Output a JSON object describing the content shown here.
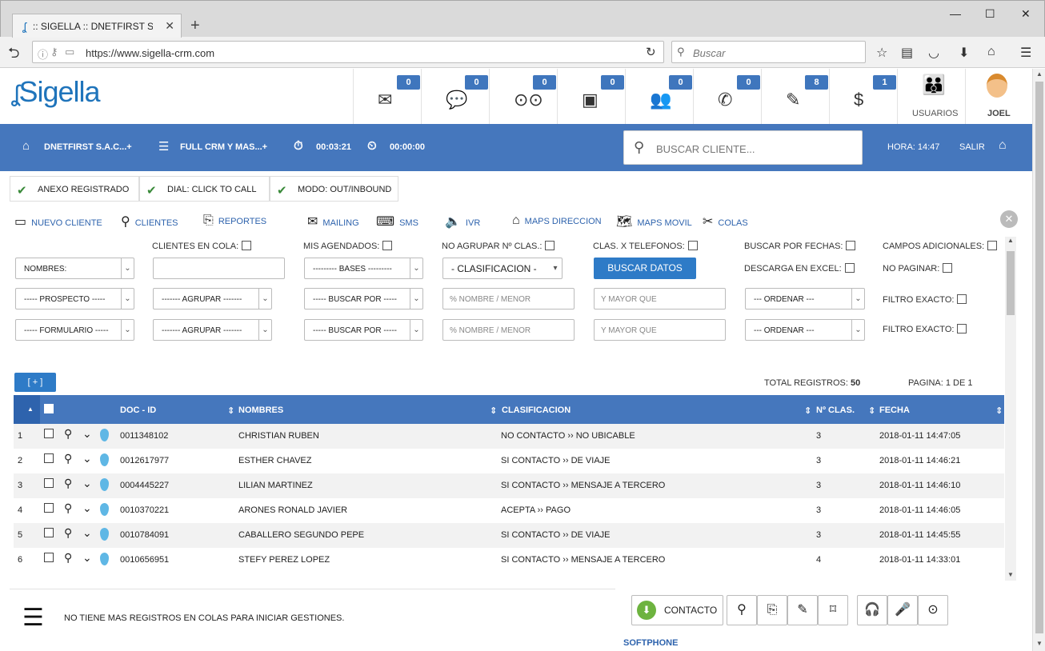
{
  "browser": {
    "tab_title": ":: SIGELLA :: DNETFIRST S....",
    "url": "https://www.sigella-crm.com",
    "search_placeholder": "Buscar"
  },
  "header": {
    "logo": "Sigella",
    "badges": [
      {
        "icon": "mail-icon",
        "count": "0"
      },
      {
        "icon": "sms-icon",
        "count": "0"
      },
      {
        "icon": "voicemail-icon",
        "count": "0"
      },
      {
        "icon": "calendar-icon",
        "count": "0"
      },
      {
        "icon": "group-icon",
        "count": "0"
      },
      {
        "icon": "phone-icon",
        "count": "0"
      },
      {
        "icon": "notes-icon",
        "count": "8"
      },
      {
        "icon": "dollar-icon",
        "count": "1"
      }
    ],
    "usuarios": "USUARIOS",
    "user": "JOEL"
  },
  "bar": {
    "company": "DNETFIRST S.A.C...+",
    "campaign": "FULL CRM Y MAS...+",
    "timer1": "00:03:21",
    "timer2": "00:00:00",
    "search_placeholder": "BUSCAR CLIENTE...",
    "hora": "HORA: 14:47",
    "salir": "SALIR"
  },
  "status": [
    "ANEXO REGISTRADO",
    "DIAL: CLICK TO CALL",
    "MODO: OUT/INBOUND"
  ],
  "menu": [
    "NUEVO CLIENTE",
    "CLIENTES",
    "REPORTES",
    "MAILING",
    "SMS",
    "IVR",
    "MAPS DIRECCION",
    "MAPS MOVIL",
    "COLAS"
  ],
  "filters": {
    "clientes_cola": "CLIENTES EN COLA:",
    "mis_agendados": "MIS AGENDADOS:",
    "no_agrupar": "NO AGRUPAR Nº CLAS.:",
    "clas_telefonos": "CLAS. X TELEFONOS:",
    "buscar_fechas": "BUSCAR POR FECHAS:",
    "campos_adicionales": "CAMPOS ADICIONALES:",
    "descarga_excel": "DESCARGA EN EXCEL:",
    "no_paginar": "NO PAGINAR:",
    "filtro_exacto": "FILTRO EXACTO:",
    "nombres": "NOMBRES:",
    "bases": "--------- BASES ---------",
    "clasificacion": "- CLASIFICACION -",
    "buscar_datos": "BUSCAR DATOS",
    "prospecto": "----- PROSPECTO -----",
    "agrupar": "------- AGRUPAR -------",
    "buscar_por": "----- BUSCAR POR -----",
    "nombre_menor": "% NOMBRE / MENOR",
    "mayor_que": "Y MAYOR QUE",
    "ordenar": "--- ORDENAR ---",
    "formulario": "----- FORMULARIO -----"
  },
  "summary": {
    "plus": "[ + ]",
    "total_label": "TOTAL REGISTROS:",
    "total": "50",
    "pagina": "PAGINA: 1 DE 1"
  },
  "table": {
    "headers": [
      "DOC - ID",
      "NOMBRES",
      "CLASIFICACION",
      "Nº CLAS.",
      "FECHA"
    ],
    "rows": [
      {
        "n": "1",
        "doc": "0011348102",
        "nombre": "CHRISTIAN RUBEN",
        "clas": "NO CONTACTO ›› NO UBICABLE",
        "num": "3",
        "fecha": "2018-01-11 14:47:05"
      },
      {
        "n": "2",
        "doc": "0012617977",
        "nombre": "ESTHER CHAVEZ",
        "clas": "SI CONTACTO ›› DE VIAJE",
        "num": "3",
        "fecha": "2018-01-11 14:46:21"
      },
      {
        "n": "3",
        "doc": "0004445227",
        "nombre": "LILIAN MARTINEZ",
        "clas": "SI CONTACTO ›› MENSAJE A TERCERO",
        "num": "3",
        "fecha": "2018-01-11 14:46:10"
      },
      {
        "n": "4",
        "doc": "0010370221",
        "nombre": "ARONES RONALD JAVIER",
        "clas": "ACEPTA ›› PAGO",
        "num": "3",
        "fecha": "2018-01-11 14:46:05"
      },
      {
        "n": "5",
        "doc": "0010784091",
        "nombre": "CABALLERO SEGUNDO PEPE",
        "clas": "SI CONTACTO ›› DE VIAJE",
        "num": "3",
        "fecha": "2018-01-11 14:45:55"
      },
      {
        "n": "6",
        "doc": "0010656951",
        "nombre": "STEFY PEREZ LOPEZ",
        "clas": "SI CONTACTO ›› MENSAJE A TERCERO",
        "num": "4",
        "fecha": "2018-01-11 14:33:01"
      }
    ]
  },
  "footer": {
    "message": "NO TIENE MAS REGISTROS EN COLAS PARA INICIAR GESTIONES.",
    "contacto": "CONTACTO",
    "softphone": "SOFTPHONE"
  }
}
